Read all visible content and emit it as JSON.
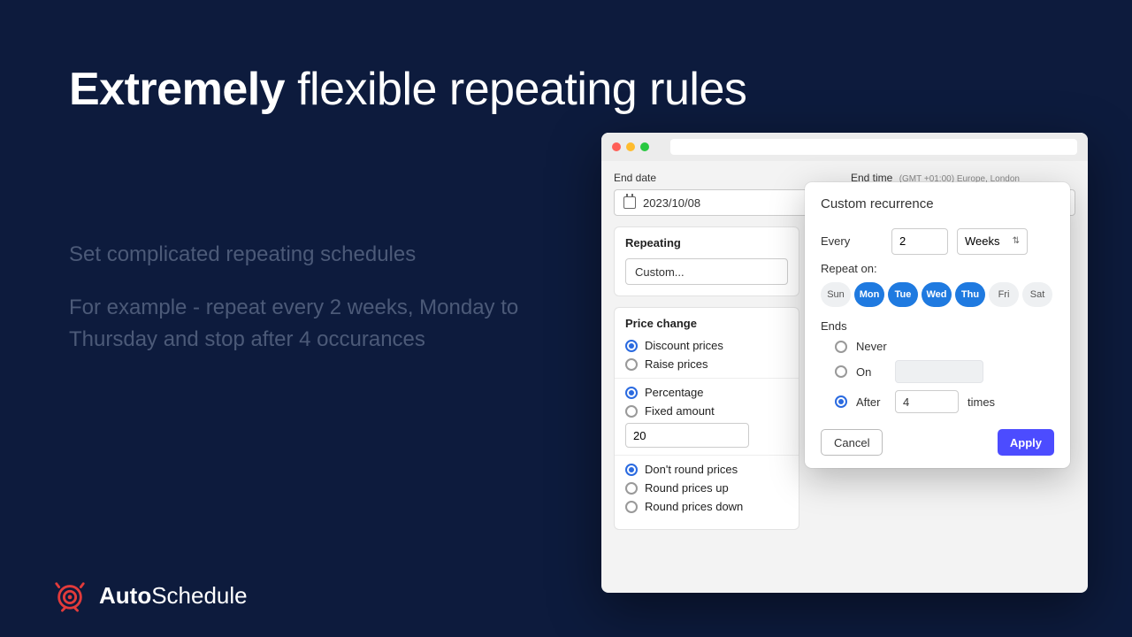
{
  "headline": {
    "bold": "Extremely",
    "rest": "flexible repeating rules"
  },
  "subcopy": {
    "p1": "Set complicated repeating schedules",
    "p2": "For example - repeat every 2 weeks, Monday to Thursday and stop after 4 occurances"
  },
  "brand": {
    "name1": "Auto",
    "name2": "Schedule"
  },
  "form": {
    "end_date_label": "End date",
    "end_date_value": "2023/10/08",
    "end_time_label": "End time",
    "end_time_tz": "(GMT +01:00) Europe, London",
    "repeating_label": "Repeating",
    "repeating_value": "Custom...",
    "price_change_label": "Price change",
    "opt_discount": "Discount prices",
    "opt_raise": "Raise prices",
    "opt_percentage": "Percentage",
    "opt_fixed": "Fixed amount",
    "amount_value": "20",
    "opt_dont_round": "Don't round prices",
    "opt_round_up": "Round prices up",
    "opt_round_down": "Round prices down"
  },
  "pop": {
    "title": "Custom recurrence",
    "every_label": "Every",
    "every_value": "2",
    "unit_value": "Weeks",
    "repeat_on_label": "Repeat on:",
    "days": [
      "Sun",
      "Mon",
      "Tue",
      "Wed",
      "Thu",
      "Fri",
      "Sat"
    ],
    "days_selected": [
      false,
      true,
      true,
      true,
      true,
      false,
      false
    ],
    "ends_label": "Ends",
    "end_never": "Never",
    "end_on": "On",
    "end_after": "After",
    "end_after_value": "4",
    "end_after_suffix": "times",
    "cancel": "Cancel",
    "apply": "Apply"
  }
}
